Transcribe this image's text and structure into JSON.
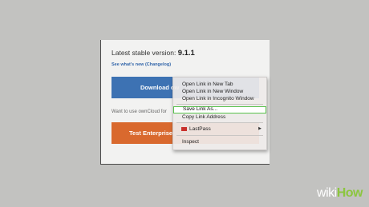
{
  "page": {
    "version_prefix": "Latest stable version: ",
    "version_number": "9.1.1",
    "changelog_link": "See what's new (Changelog)",
    "download_button": "Download ow",
    "want_text": "Want to use ownCloud for",
    "enterprise_button": "Test Enterprise"
  },
  "context_menu": {
    "items": [
      "Open Link in New Tab",
      "Open Link in New Window",
      "Open Link in Incognito Window",
      "Save Link As...",
      "Copy Link Address",
      "LastPass",
      "Inspect"
    ],
    "lastpass_arrow": "▶"
  },
  "watermark": {
    "part1": "wiki",
    "part2": "How"
  },
  "colors": {
    "background": "#c2c2c0",
    "download_button": "#3d72b3",
    "enterprise_button": "#d9692e",
    "highlight_border": "#56c14a",
    "link": "#3366aa"
  }
}
